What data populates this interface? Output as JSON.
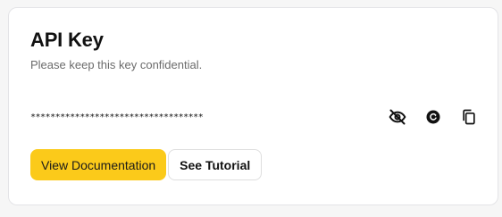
{
  "card": {
    "title": "API Key",
    "subtitle": "Please keep this key confidential.",
    "masked_key": "***********************************",
    "icons": {
      "visibility": "eye-off-icon",
      "regenerate": "refresh-icon",
      "copy": "copy-icon"
    },
    "buttons": {
      "primary_label": "View Documentation",
      "secondary_label": "See Tutorial"
    }
  },
  "colors": {
    "accent": "#fbca1a",
    "background": "#f6f6f6",
    "card": "#ffffff",
    "muted_text": "#6b6b6b"
  }
}
